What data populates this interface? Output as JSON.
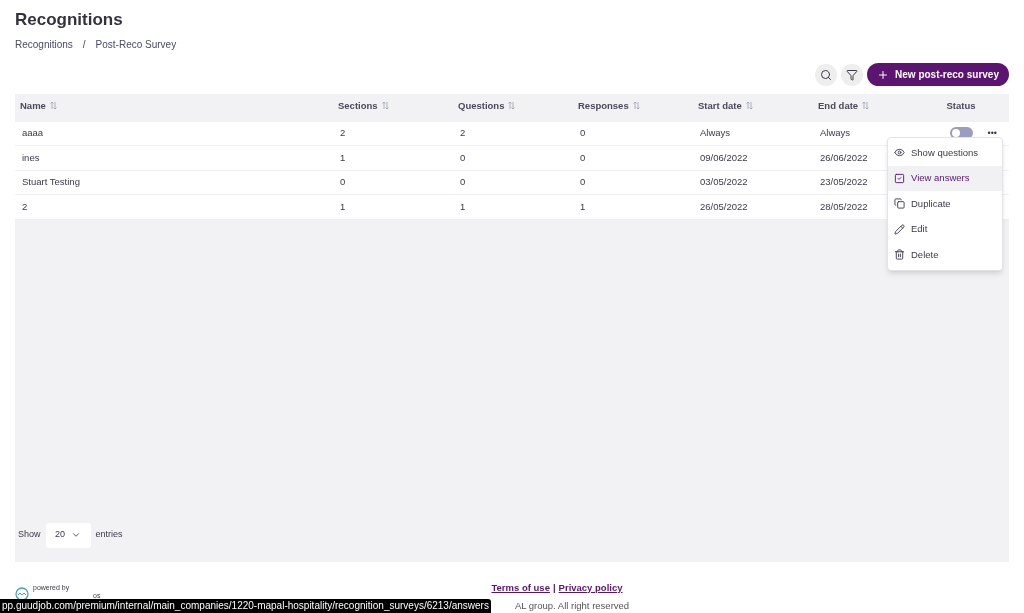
{
  "title": "Recognitions",
  "breadcrumb": [
    "Recognitions",
    "/",
    "Post-Reco Survey"
  ],
  "new_button": {
    "label": "New post-reco survey"
  },
  "table": {
    "columns": [
      {
        "label": "Name",
        "sortable": true
      },
      {
        "label": "Sections",
        "sortable": true
      },
      {
        "label": "Questions",
        "sortable": true
      },
      {
        "label": "Responses",
        "sortable": true
      },
      {
        "label": "Start date",
        "sortable": true
      },
      {
        "label": "End date",
        "sortable": true
      },
      {
        "label": "Status",
        "sortable": false
      }
    ],
    "rows": [
      {
        "cells": [
          "aaaa",
          "2",
          "2",
          "0",
          "Always",
          "Always"
        ],
        "status": {
          "on": false
        },
        "more": "•••"
      },
      {
        "cells": [
          "ines",
          "1",
          "0",
          "0",
          "09/06/2022",
          "26/06/2022"
        ]
      },
      {
        "cells": [
          "Stuart Testing",
          "0",
          "0",
          "0",
          "03/05/2022",
          "23/05/2022"
        ]
      },
      {
        "cells": [
          "2",
          "1",
          "1",
          "1",
          "26/05/2022",
          "28/05/2022"
        ]
      }
    ]
  },
  "menu": [
    {
      "kind": "eye",
      "label": "Show questions",
      "selected": false
    },
    {
      "kind": "check",
      "label": "View answers",
      "selected": true
    },
    {
      "kind": "copy",
      "label": "Duplicate",
      "selected": false
    },
    {
      "kind": "edit",
      "label": "Edit",
      "selected": false
    },
    {
      "kind": "trash",
      "label": "Delete",
      "selected": false
    }
  ],
  "pager": {
    "show": "Show",
    "value": "20",
    "entries": "entries"
  },
  "footer": {
    "powered_by": "powered by",
    "logo_suffix": "os",
    "links": [
      "Terms of use",
      "|",
      "Privacy policy"
    ],
    "copyright": "AL group. All right reserved"
  },
  "status_url": "pp.guudjob.com/premium/internal/main_companies/1220-mapal-hospitality/recognition_surveys/6213/answers"
}
